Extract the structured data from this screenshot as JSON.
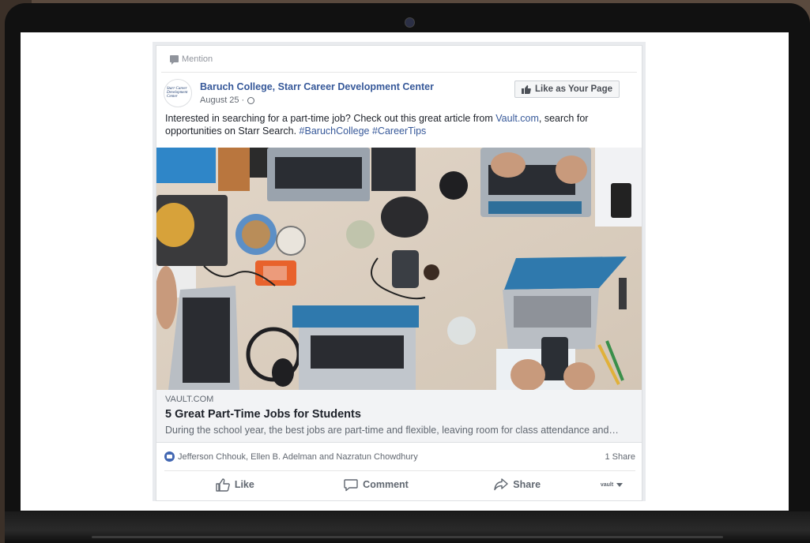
{
  "mention": {
    "label": "Mention"
  },
  "post": {
    "page_name": "Baruch College, Starr Career Development Center",
    "avatar_text": "Starr Career Development Center",
    "date": "August 25",
    "separator": "·",
    "like_page_button": "Like as Your Page",
    "text_before": "Interested in searching for a part-time job? Check out this great article from ",
    "text_link": "Vault.com",
    "text_middle": ", search for opportunities on Starr Search. ",
    "hashtag_1": "#BaruchCollege",
    "hashtag_2": "#CareerTips"
  },
  "link_preview": {
    "domain": "VAULT.COM",
    "title": "5 Great Part-Time Jobs for Students",
    "description": "During the school year, the best jobs are part-time and flexible, leaving room for class attendance and…"
  },
  "reactions": {
    "names": "Jefferson Chhouk, Ellen B. Adelman and Nazratun Chowdhury",
    "shares": "1 Share"
  },
  "actions": {
    "like": "Like",
    "comment": "Comment",
    "share": "Share",
    "post_as": "vault"
  },
  "colors": {
    "link_blue": "#365899",
    "fb_blue": "#4267b2",
    "text": "#1d2129",
    "muted": "#606770"
  },
  "icons": [
    "comment-bubble-icon",
    "globe-icon",
    "thumbs-up-icon",
    "comment-icon",
    "share-arrow-icon",
    "caret-down-icon",
    "camera-icon"
  ]
}
